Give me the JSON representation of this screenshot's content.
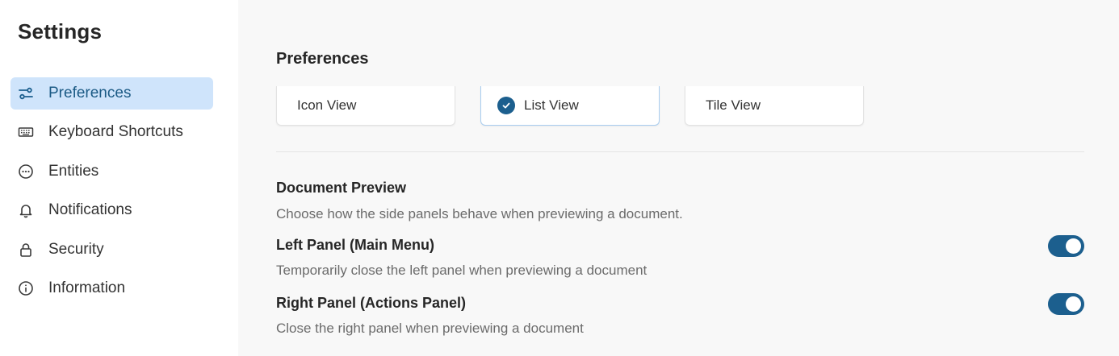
{
  "sidebar": {
    "title": "Settings",
    "items": [
      {
        "label": "Preferences",
        "icon": "sliders-icon",
        "active": true
      },
      {
        "label": "Keyboard Shortcuts",
        "icon": "keyboard-icon",
        "active": false
      },
      {
        "label": "Entities",
        "icon": "ellipsis-circle-icon",
        "active": false
      },
      {
        "label": "Notifications",
        "icon": "bell-icon",
        "active": false
      },
      {
        "label": "Security",
        "icon": "lock-icon",
        "active": false
      },
      {
        "label": "Information",
        "icon": "info-icon",
        "active": false
      }
    ]
  },
  "main": {
    "section_title": "Preferences",
    "view_options": [
      {
        "label": "Icon View",
        "selected": false
      },
      {
        "label": "List View",
        "selected": true
      },
      {
        "label": "Tile View",
        "selected": false
      }
    ],
    "document_preview": {
      "title": "Document Preview",
      "description": "Choose how the side panels behave when previewing a document.",
      "options": [
        {
          "title": "Left Panel (Main Menu)",
          "description": "Temporarily close the left panel when previewing a document",
          "enabled": true
        },
        {
          "title": "Right Panel (Actions Panel)",
          "description": "Close the right panel when previewing a document",
          "enabled": true
        }
      ]
    }
  },
  "colors": {
    "accent": "#1c5f8e",
    "active_bg": "#cfe4fb",
    "main_bg": "#f8f8f8"
  }
}
